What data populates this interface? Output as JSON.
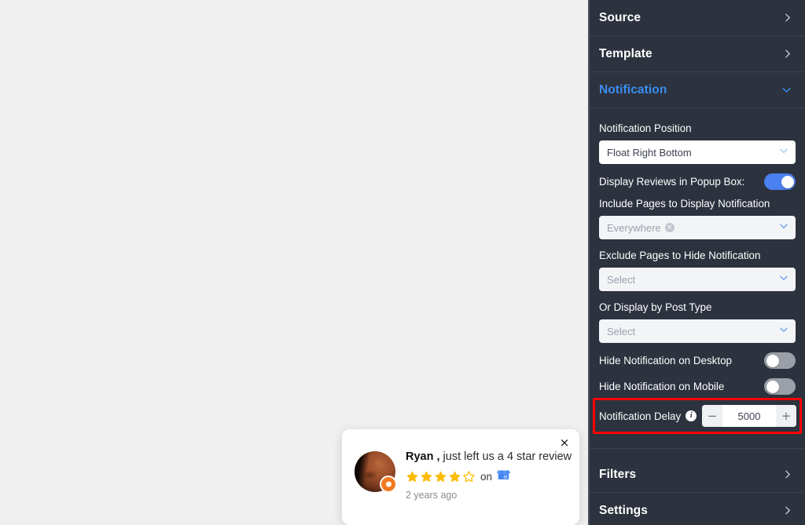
{
  "canvas": {
    "background_color": "#f0f0f0"
  },
  "review_popup": {
    "close_icon": "×",
    "reviewer_name": "Ryan ,",
    "action_text": " just left us a 4 star review",
    "rating": 4,
    "max_rating": 5,
    "on_label": "on",
    "platform_icon": "google-business-profile-icon",
    "time_ago": "2 years ago",
    "star_color": "#fbbc04",
    "badge_color": "#f3791f"
  },
  "sidebar": {
    "background_color": "#2c323e",
    "accent_color": "#3b8ef0",
    "sections": [
      {
        "id": "source",
        "label": "Source",
        "expanded": false
      },
      {
        "id": "template",
        "label": "Template",
        "expanded": false
      },
      {
        "id": "notification",
        "label": "Notification",
        "expanded": true
      },
      {
        "id": "filters",
        "label": "Filters",
        "expanded": false
      },
      {
        "id": "settings",
        "label": "Settings",
        "expanded": false
      }
    ],
    "notification": {
      "position_label": "Notification Position",
      "position_value": "Float Right Bottom",
      "display_reviews_label": "Display Reviews in Popup Box:",
      "display_reviews_on": true,
      "include_pages_label": "Include Pages to Display Notification",
      "include_pages_tag": "Everywhere",
      "include_pages_remove_icon": "×",
      "exclude_pages_label": "Exclude Pages to Hide Notification",
      "exclude_pages_placeholder": "Select",
      "post_type_label": "Or Display by Post Type",
      "post_type_placeholder": "Select",
      "hide_desktop_label": "Hide Notification on Desktop",
      "hide_desktop_on": false,
      "hide_mobile_label": "Hide Notification on Mobile",
      "hide_mobile_on": false,
      "delay_label": "Notification Delay",
      "delay_info_icon": "i",
      "delay_decrement": "−",
      "delay_value": "5000",
      "delay_increment": "+",
      "highlight_color": "#ff0000"
    }
  }
}
